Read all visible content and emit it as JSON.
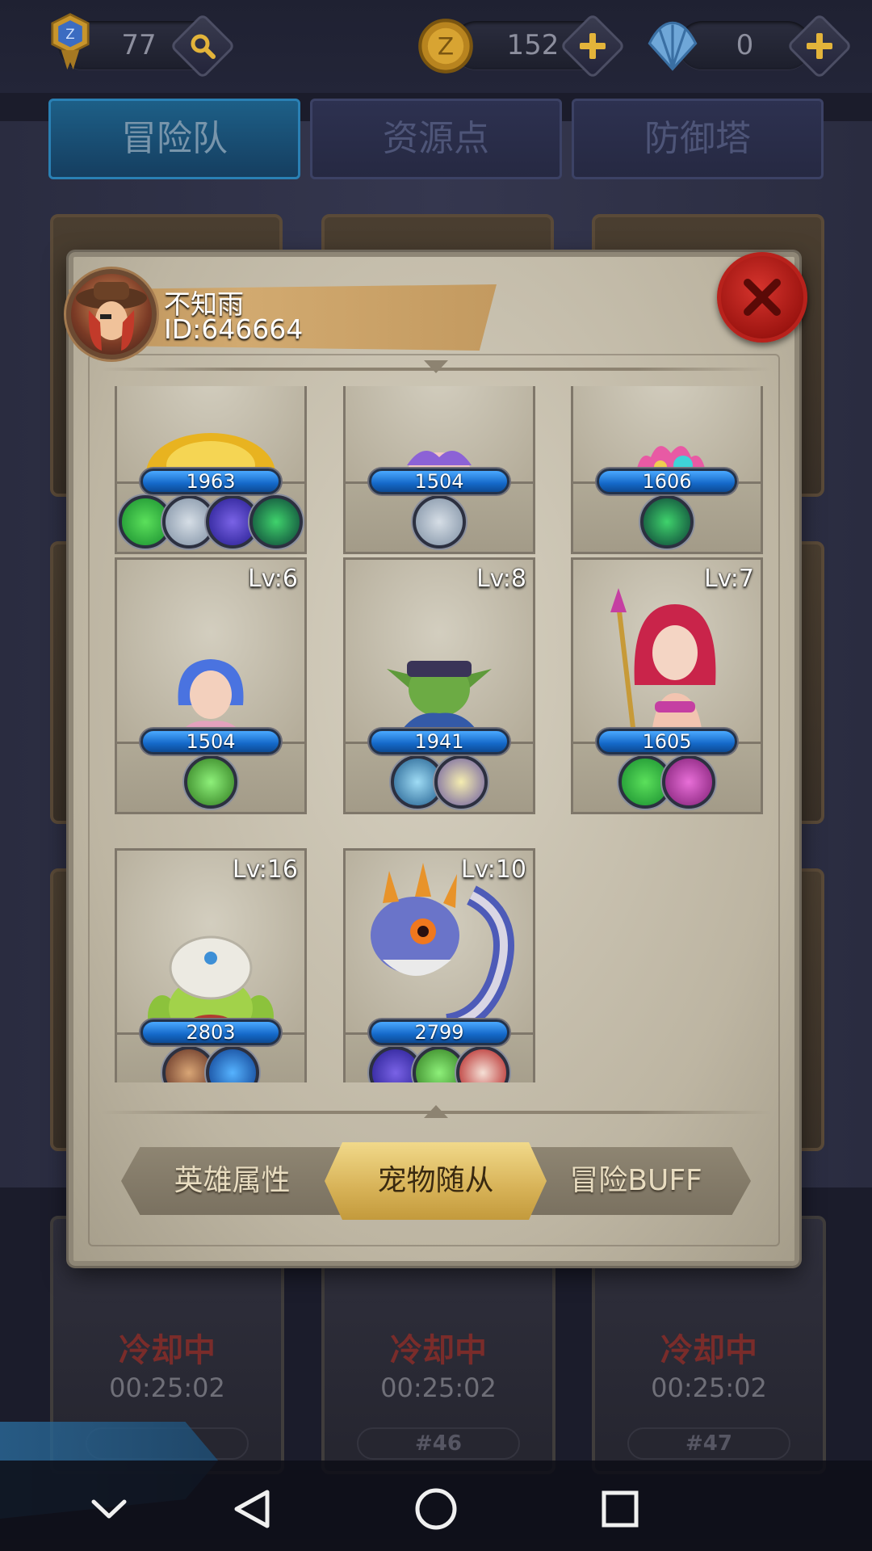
{
  "resources": {
    "level": "77",
    "coins": "152",
    "shells": "0"
  },
  "tabs": [
    "冒险队",
    "资源点",
    "防御塔"
  ],
  "background_cards": {
    "cooldown_label": "冷却中",
    "timers": [
      "00:25:02",
      "00:25:02",
      "00:25:02"
    ],
    "numbers": [
      "",
      "#46",
      "#47"
    ]
  },
  "player": {
    "name": "不知雨",
    "id": "ID:646664"
  },
  "heroes": [
    {
      "lv": "",
      "power": "1963",
      "skills": [
        "sword-skill-icon",
        "shield-skill-icon",
        "vortex-skill-icon",
        "flame-skill-icon"
      ],
      "art": "golden-helmet-hero"
    },
    {
      "lv": "",
      "power": "1504",
      "skills": [
        "shield-skill-icon"
      ],
      "art": "purple-hair-hero"
    },
    {
      "lv": "",
      "power": "1606",
      "skills": [
        "flame-skill-icon"
      ],
      "art": "coral-crown-hero"
    },
    {
      "lv": "Lv:6",
      "power": "1504",
      "skills": [
        "heal-skill-icon"
      ],
      "art": "blue-hair-mermaid-hero"
    },
    {
      "lv": "Lv:8",
      "power": "1941",
      "skills": [
        "lightning-skill-icon",
        "bug-skill-icon"
      ],
      "art": "goblin-hero"
    },
    {
      "lv": "Lv:7",
      "power": "1605",
      "skills": [
        "sword-skill-icon",
        "music-skill-icon"
      ],
      "art": "red-hair-sorceress-hero"
    },
    {
      "lv": "Lv:16",
      "power": "2803",
      "skills": [
        "warrior-skill-icon",
        "crystal-skill-icon"
      ],
      "art": "turban-cactus-hero"
    },
    {
      "lv": "Lv:10",
      "power": "2799",
      "skills": [
        "vortex-skill-icon",
        "heal-skill-icon",
        "horn-skill-icon"
      ],
      "art": "serpent-dragon-hero"
    }
  ],
  "bottom_tabs": [
    "英雄属性",
    "宠物随从",
    "冒险BUFF"
  ],
  "bottom_tab_selected": "宠物随从",
  "colors": {
    "power_bar": "#1468c8",
    "close_button": "#b8221c",
    "active_tab": "#d7b257"
  }
}
